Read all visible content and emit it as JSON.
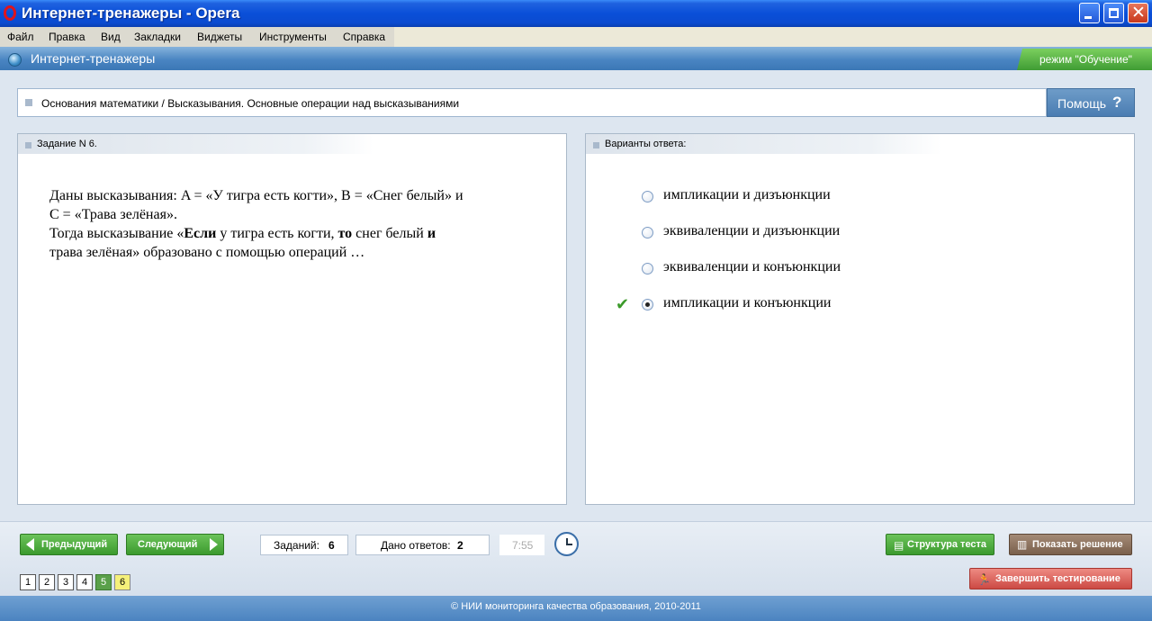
{
  "window": {
    "title": "Интернет-тренажеры - Opera",
    "app_icon": "opera-icon",
    "controls": {
      "minimize": "minimize-icon",
      "maximize": "restore-icon",
      "close": "close-icon"
    }
  },
  "menubar": {
    "items": [
      "Файл",
      "Правка",
      "Вид",
      "Закладки",
      "Виджеты",
      "Инструменты",
      "Справка"
    ]
  },
  "header": {
    "app_title": "Интернет-тренажеры",
    "mode": "режим \"Обучение\""
  },
  "topic": {
    "breadcrumb": "Основания математики / Высказывания. Основные операции над высказываниями",
    "help_label": "Помощь",
    "help_icon": "?"
  },
  "task": {
    "header": "Задание N 6.",
    "line1": "Даны высказывания: A = «У тигра есть когти», B = «Снег белый» и",
    "line2": "C = «Трава зелёная».",
    "line3_a": "Тогда высказывание «",
    "line3_b": "Если",
    "line3_c": " у тигра есть когти, ",
    "line3_d": "то",
    "line3_e": " снег белый ",
    "line3_f": "и",
    "line4": "трава зелёная» образовано с помощью операций …"
  },
  "answers": {
    "header": "Варианты ответа:",
    "options": [
      {
        "label": "импликации и дизъюнкции",
        "selected": false,
        "correct": false
      },
      {
        "label": "эквиваленции и дизъюнкции",
        "selected": false,
        "correct": false
      },
      {
        "label": "эквиваленции и конъюнкции",
        "selected": false,
        "correct": false
      },
      {
        "label": "импликации и конъюнкции",
        "selected": true,
        "correct": true
      }
    ]
  },
  "nav": {
    "prev_label": "Предыдущий",
    "next_label": "Следующий",
    "tasks_label": "Заданий:",
    "tasks_count": "6",
    "answers_label": "Дано ответов:",
    "answers_count": "2",
    "timer": "7:55",
    "structure_label": "Структура теста",
    "solution_label": "Показать решение",
    "finish_label": "Завершить тестирование",
    "question_numbers": [
      "1",
      "2",
      "3",
      "4",
      "5",
      "6"
    ],
    "answered_index": 4,
    "current_index": 5
  },
  "footer": {
    "copyright": "© НИИ мониторинга качества образования, 2010-2011"
  },
  "colors": {
    "titlebar": "#0a4fd8",
    "accent_green": "#3b9a2e",
    "finish_red": "#cc4a44",
    "solution_brown": "#7a604c"
  }
}
